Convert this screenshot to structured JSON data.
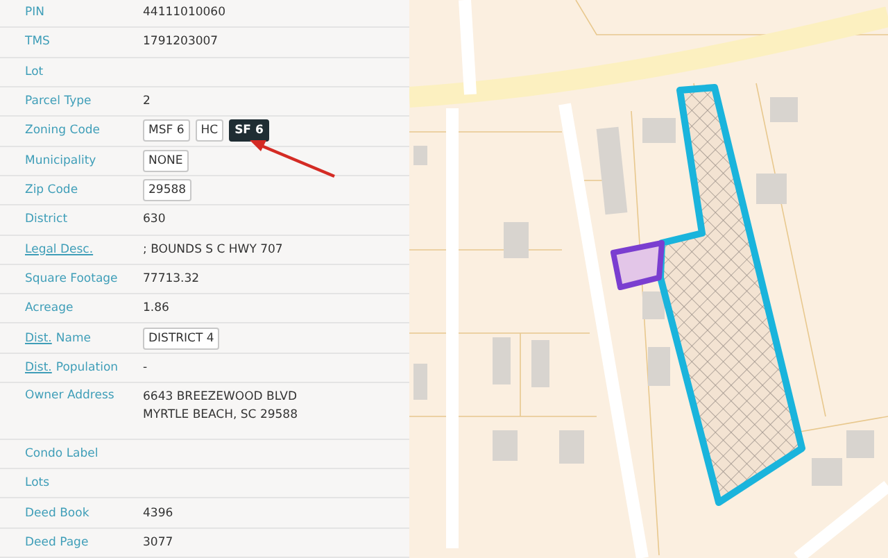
{
  "rows": [
    {
      "kind": "text",
      "label": "PIN",
      "value": "44111010060"
    },
    {
      "kind": "text",
      "label": "TMS",
      "value": "1791203007"
    },
    {
      "kind": "text",
      "label": "Lot"
    },
    {
      "kind": "text",
      "label": "Parcel Type",
      "value": "2"
    },
    {
      "kind": "chips",
      "label": "Zoning Code",
      "chips": [
        {
          "text": "MSF 6",
          "selected": false
        },
        {
          "text": "HC",
          "selected": false
        },
        {
          "text": "SF 6",
          "selected": true
        }
      ]
    },
    {
      "kind": "chips",
      "label": "Municipality",
      "chips": [
        {
          "text": "NONE",
          "selected": false
        }
      ]
    },
    {
      "kind": "chips",
      "label": "Zip Code",
      "chips": [
        {
          "text": "29588",
          "selected": false
        }
      ]
    },
    {
      "kind": "text",
      "label": "District",
      "value": "630"
    },
    {
      "kind": "text",
      "link": "Legal Desc.",
      "value": "; BOUNDS S C HWY 707"
    },
    {
      "kind": "text",
      "label": "Square Footage",
      "value": "77713.32"
    },
    {
      "kind": "text",
      "label": "Acreage",
      "value": "1.86"
    },
    {
      "kind": "chips",
      "link": "Dist.",
      "label": "Name",
      "chips": [
        {
          "text": "DISTRICT 4",
          "selected": false
        }
      ]
    },
    {
      "kind": "text",
      "link": "Dist.",
      "label": "Population",
      "value": "-"
    },
    {
      "kind": "lines",
      "label": "Owner Address",
      "lines": [
        "6643 BREEZEWOOD BLVD",
        "MYRTLE BEACH, SC 29588"
      ]
    },
    {
      "kind": "text",
      "label": "Condo Label"
    },
    {
      "kind": "text",
      "label": "Lots"
    },
    {
      "kind": "text",
      "label": "Deed Book",
      "value": "4396"
    },
    {
      "kind": "text",
      "label": "Deed Page",
      "value": "3077"
    }
  ]
}
